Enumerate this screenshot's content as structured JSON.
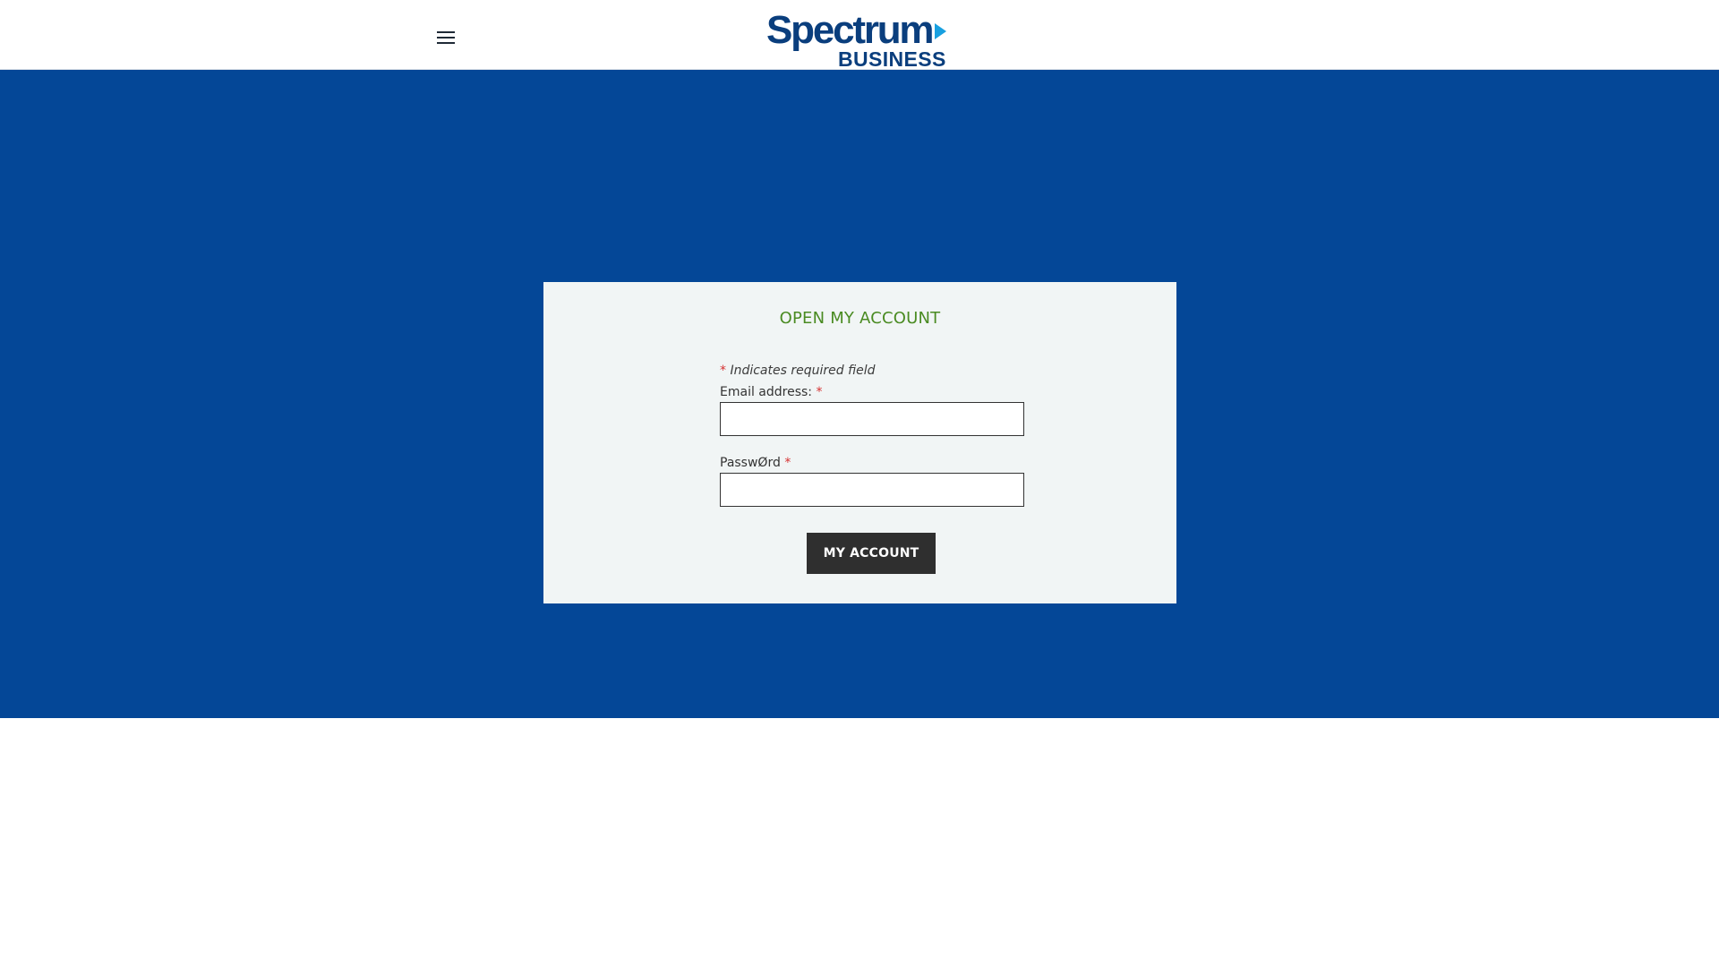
{
  "header": {
    "menu_icon": "hamburger-menu-icon",
    "logo": {
      "line1": "Spectrum",
      "line2": "BUSINESS",
      "arrow_color": "#18a0e0",
      "text_color": "#0a3e7d"
    }
  },
  "colors": {
    "hero_background": "#044797",
    "title_color": "#4a8b22",
    "required_star": "#d63232",
    "button_background": "#2f2f2f"
  },
  "card": {
    "title": "OPEN MY ACCOUNT",
    "required_note": "Indicates required field",
    "required_marker": "*",
    "email_label": "Email address:",
    "email_value": "",
    "password_label": "PasswØrd",
    "password_value": "",
    "submit_label": "MY ACCOUNT"
  }
}
